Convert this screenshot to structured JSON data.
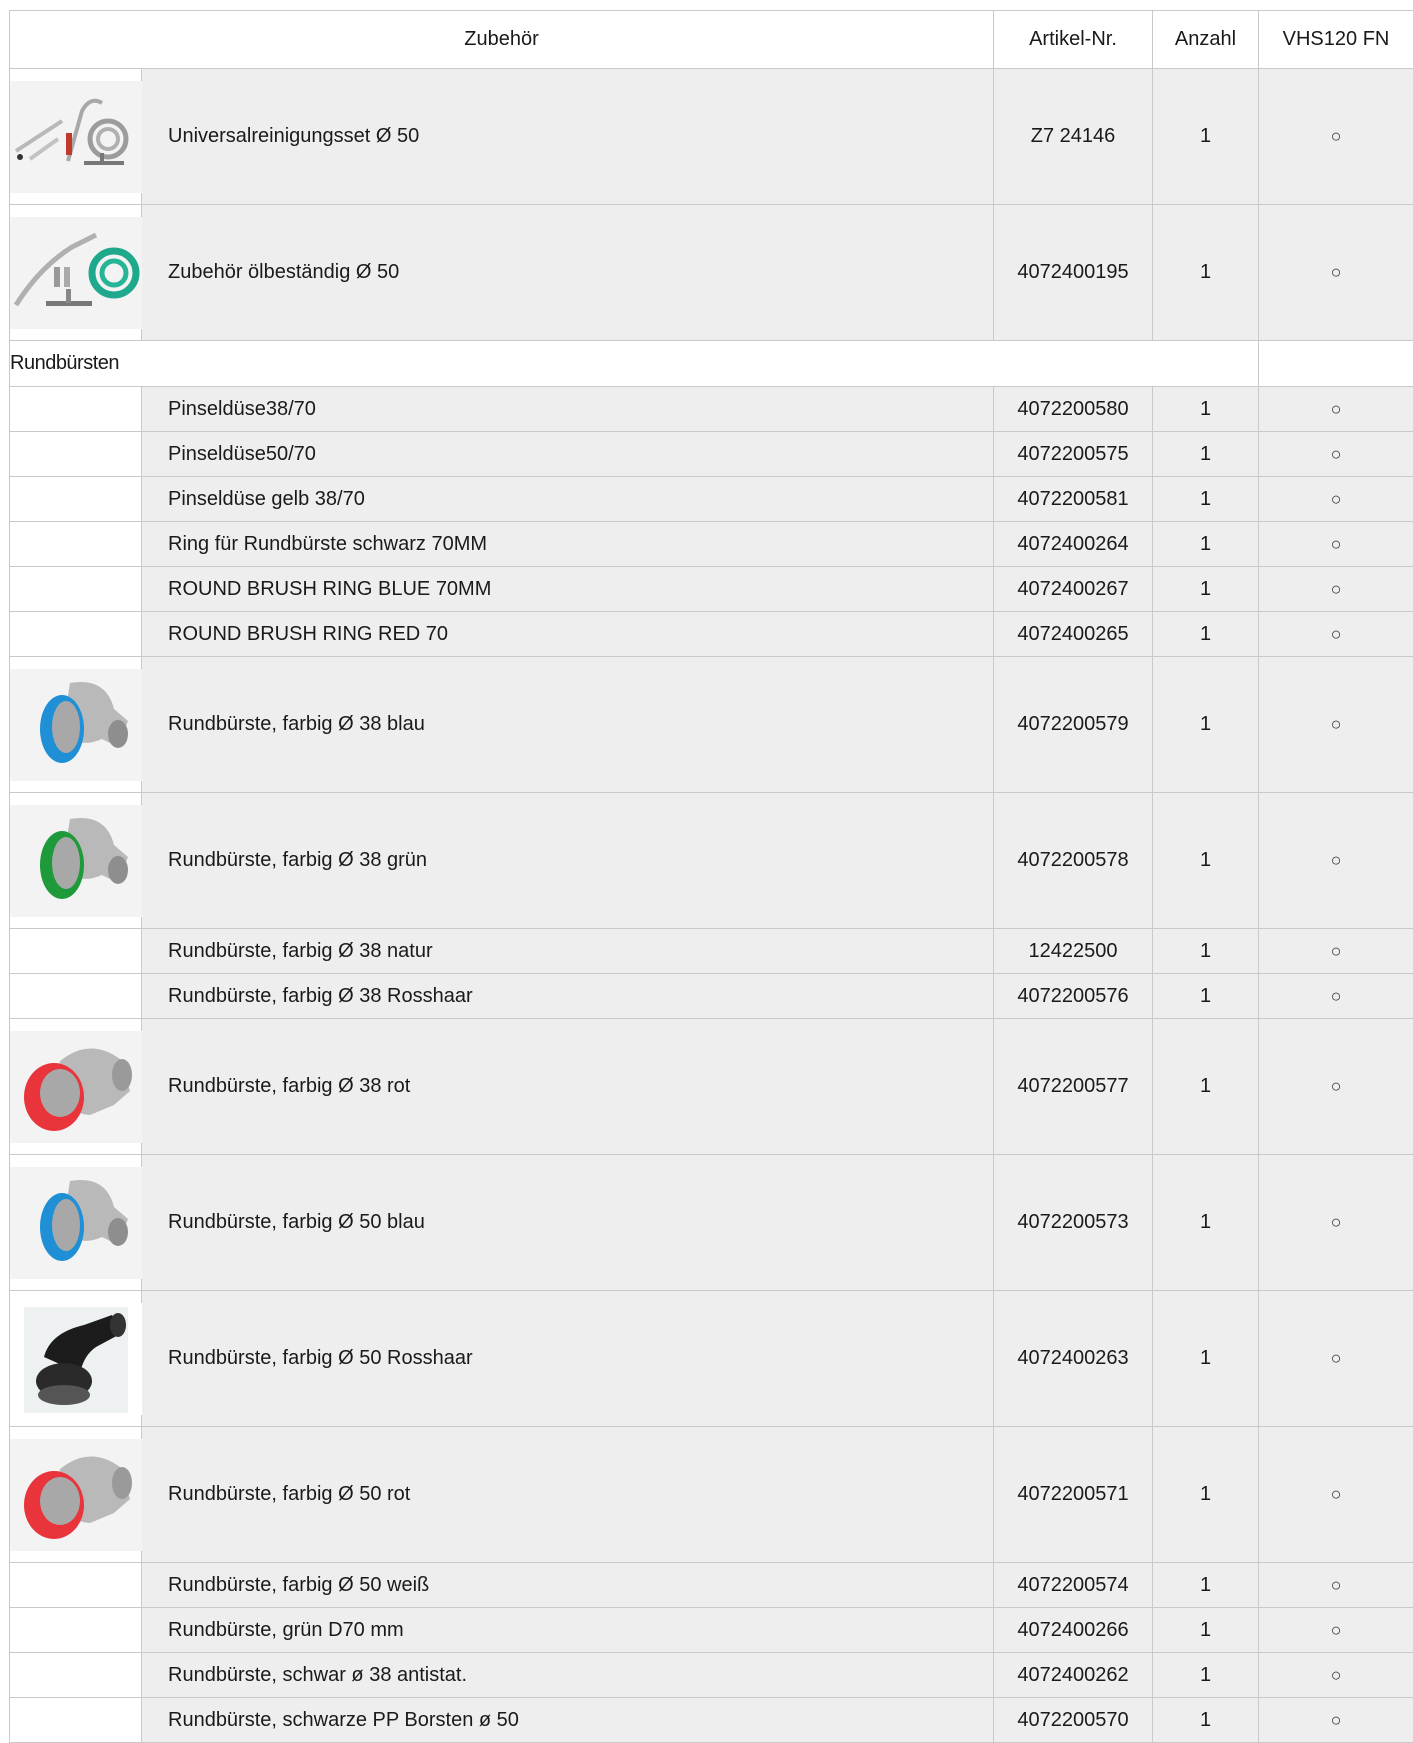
{
  "header": {
    "col_accessory": "Zubehör",
    "col_article": "Artikel-Nr.",
    "col_count": "Anzahl",
    "col_model": "VHS120 FN"
  },
  "rows": [
    {
      "name": "Universalreinigungsset Ø 50",
      "article": "Z7 24146",
      "count": "1",
      "mark": "○",
      "image": "cleaning-set-grey-icon"
    },
    {
      "name": "Zubehör ölbeständig Ø 50",
      "article": "4072400195",
      "count": "1",
      "mark": "○",
      "image": "oil-resistant-set-green-icon"
    },
    {
      "name": "Pinseldüse38/70",
      "article": "4072200580",
      "count": "1",
      "mark": "○"
    },
    {
      "name": "Pinseldüse50/70",
      "article": "4072200575",
      "count": "1",
      "mark": "○"
    },
    {
      "name": "Pinseldüse gelb 38/70",
      "article": "4072200581",
      "count": "1",
      "mark": "○"
    },
    {
      "name": "Ring für Rundbürste schwarz 70MM",
      "article": "4072400264",
      "count": "1",
      "mark": "○"
    },
    {
      "name": "ROUND BRUSH RING BLUE 70MM",
      "article": "4072400267",
      "count": "1",
      "mark": "○"
    },
    {
      "name": "ROUND BRUSH RING RED 70",
      "article": "4072400265",
      "count": "1",
      "mark": "○"
    },
    {
      "name": "Rundbürste, farbig Ø 38 blau",
      "article": "4072200579",
      "count": "1",
      "mark": "○",
      "image": "round-brush-blue-icon"
    },
    {
      "name": "Rundbürste, farbig Ø 38 grün",
      "article": "4072200578",
      "count": "1",
      "mark": "○",
      "image": "round-brush-green-icon"
    },
    {
      "name": "Rundbürste, farbig Ø 38 natur",
      "article": "12422500",
      "count": "1",
      "mark": "○"
    },
    {
      "name": "Rundbürste, farbig Ø 38 Rosshaar",
      "article": "4072200576",
      "count": "1",
      "mark": "○"
    },
    {
      "name": "Rundbürste, farbig Ø 38 rot",
      "article": "4072200577",
      "count": "1",
      "mark": "○",
      "image": "round-brush-red-icon"
    },
    {
      "name": "Rundbürste, farbig Ø 50 blau",
      "article": "4072200573",
      "count": "1",
      "mark": "○",
      "image": "round-brush-blue-icon"
    },
    {
      "name": "Rundbürste, farbig Ø 50 Rosshaar",
      "article": "4072400263",
      "count": "1",
      "mark": "○",
      "image": "round-brush-black-icon"
    },
    {
      "name": "Rundbürste, farbig Ø 50 rot",
      "article": "4072200571",
      "count": "1",
      "mark": "○",
      "image": "round-brush-red-icon"
    },
    {
      "name": "Rundbürste, farbig Ø 50 weiß",
      "article": "4072200574",
      "count": "1",
      "mark": "○"
    },
    {
      "name": "Rundbürste, grün D70 mm",
      "article": "4072400266",
      "count": "1",
      "mark": "○"
    },
    {
      "name": "Rundbürste, schwar ø 38 antistat.",
      "article": "4072400262",
      "count": "1",
      "mark": "○"
    },
    {
      "name": "Rundbürste, schwarze PP Borsten ø 50",
      "article": "4072200570",
      "count": "1",
      "mark": "○"
    }
  ],
  "section": {
    "title": "Rundbürsten"
  },
  "colors": {
    "row_bg": "#eeeeee",
    "border": "#c9c9c9",
    "brush_blue": "#1f8fd6",
    "brush_green": "#1f9a3a",
    "brush_red": "#e8343a",
    "hose_green": "#1fa98c"
  }
}
